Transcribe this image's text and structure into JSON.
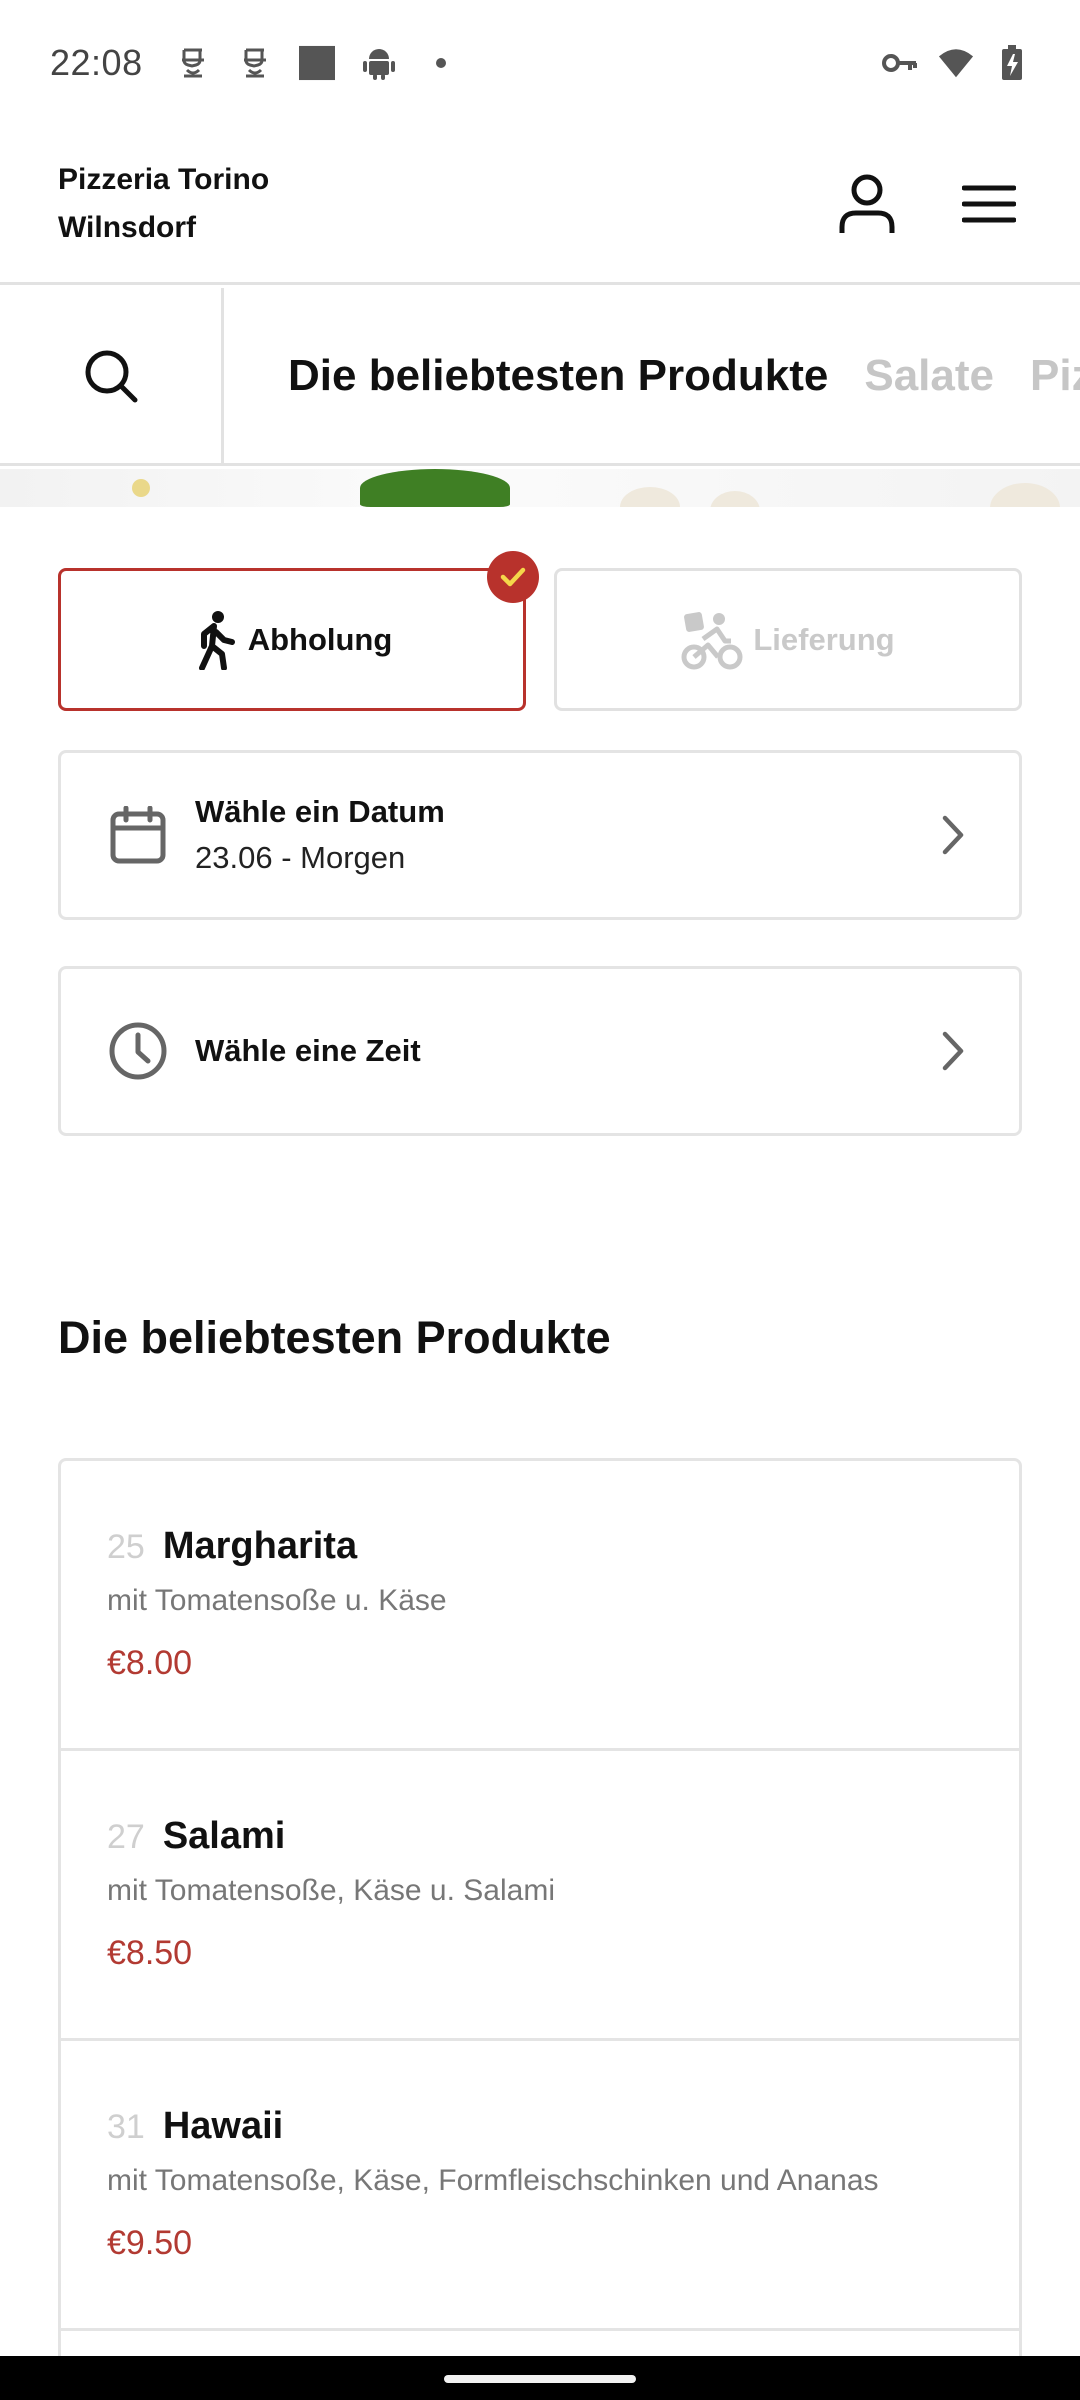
{
  "status_bar": {
    "time": "22:08",
    "left_icons": [
      "face-icon",
      "face-icon",
      "square-icon",
      "android-icon",
      "dot-icon"
    ],
    "right_icons": [
      "vpn-key-icon",
      "wifi-icon",
      "battery-charging-icon"
    ]
  },
  "header": {
    "brand_line1": "Pizzeria Torino",
    "brand_line2": "Wilnsdorf",
    "icons": [
      "user-icon",
      "menu-icon"
    ]
  },
  "categories": {
    "search_icon": "search-icon",
    "tabs": [
      {
        "label": "Die beliebtesten Produkte",
        "active": true
      },
      {
        "label": "Salate",
        "active": false
      },
      {
        "label": "Pizza",
        "active": false
      }
    ]
  },
  "order_mode": {
    "pickup_label": "Abholung",
    "delivery_label": "Lieferung",
    "selected": "pickup",
    "accent_color": "#b8322c",
    "check_color": "#f5d64a"
  },
  "date_select": {
    "title": "Wähle ein Datum",
    "value": "23.06 - Morgen"
  },
  "time_select": {
    "title": "Wähle eine Zeit"
  },
  "section": {
    "title": "Die beliebtesten Produkte"
  },
  "products": [
    {
      "number": "25",
      "name": "Margharita",
      "description": "mit Tomatensoße u. Käse",
      "price": "€8.00"
    },
    {
      "number": "27",
      "name": "Salami",
      "description": "mit Tomatensoße, Käse u. Salami",
      "price": "€8.50"
    },
    {
      "number": "31",
      "name": "Hawaii",
      "description": "mit Tomatensoße, Käse, Formfleischschinken und Ananas",
      "price": "€9.50"
    }
  ],
  "price_color": "#b23a32"
}
